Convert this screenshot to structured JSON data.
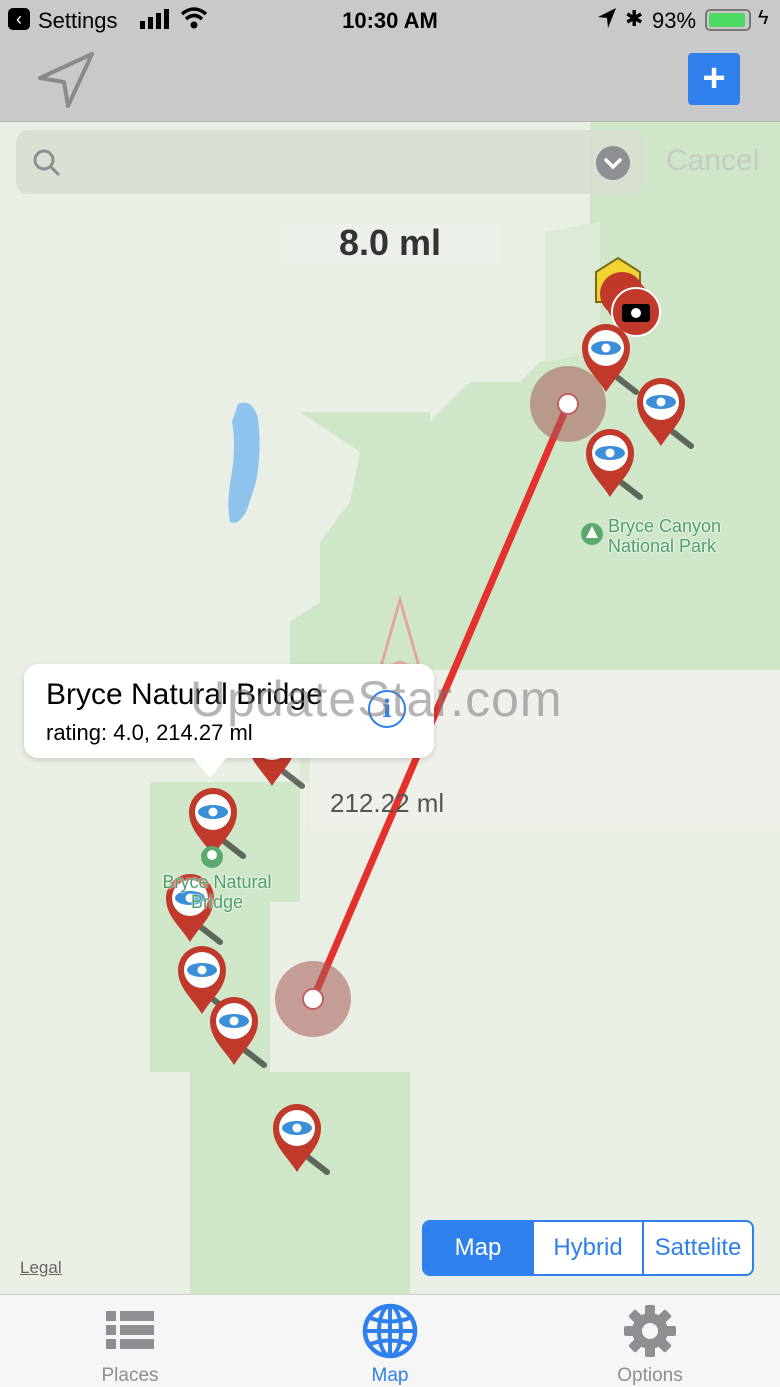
{
  "status_bar": {
    "back_app": "Settings",
    "time": "10:30 AM",
    "battery": "93%"
  },
  "toolbar": {
    "add_label": "+"
  },
  "search": {
    "placeholder": "",
    "cancel_label": "Cancel"
  },
  "map": {
    "scale": "8.0 ml",
    "distance": "212.22 ml",
    "watermark": "UpdateStar.com",
    "legal": "Legal",
    "poi": [
      {
        "line1": "Bryce Canyon",
        "line2": "National Park"
      },
      {
        "line1": "Bryce Natural",
        "line2": "Bridge"
      }
    ],
    "colors": {
      "route": "#e5312c",
      "pin": "#c0392b",
      "accent": "#2f80ed",
      "park": "#c8e4c4"
    }
  },
  "callout": {
    "title": "Bryce Natural Bridge",
    "subtitle": "rating: 4.0, 214.27 ml",
    "info_icon": "i"
  },
  "map_type": {
    "options": [
      "Map",
      "Hybrid",
      "Sattelite"
    ],
    "selected": "Map"
  },
  "tabs": [
    {
      "label": "Places",
      "icon": "list-icon",
      "active": false
    },
    {
      "label": "Map",
      "icon": "globe-icon",
      "active": true
    },
    {
      "label": "Options",
      "icon": "gear-icon",
      "active": false
    }
  ]
}
